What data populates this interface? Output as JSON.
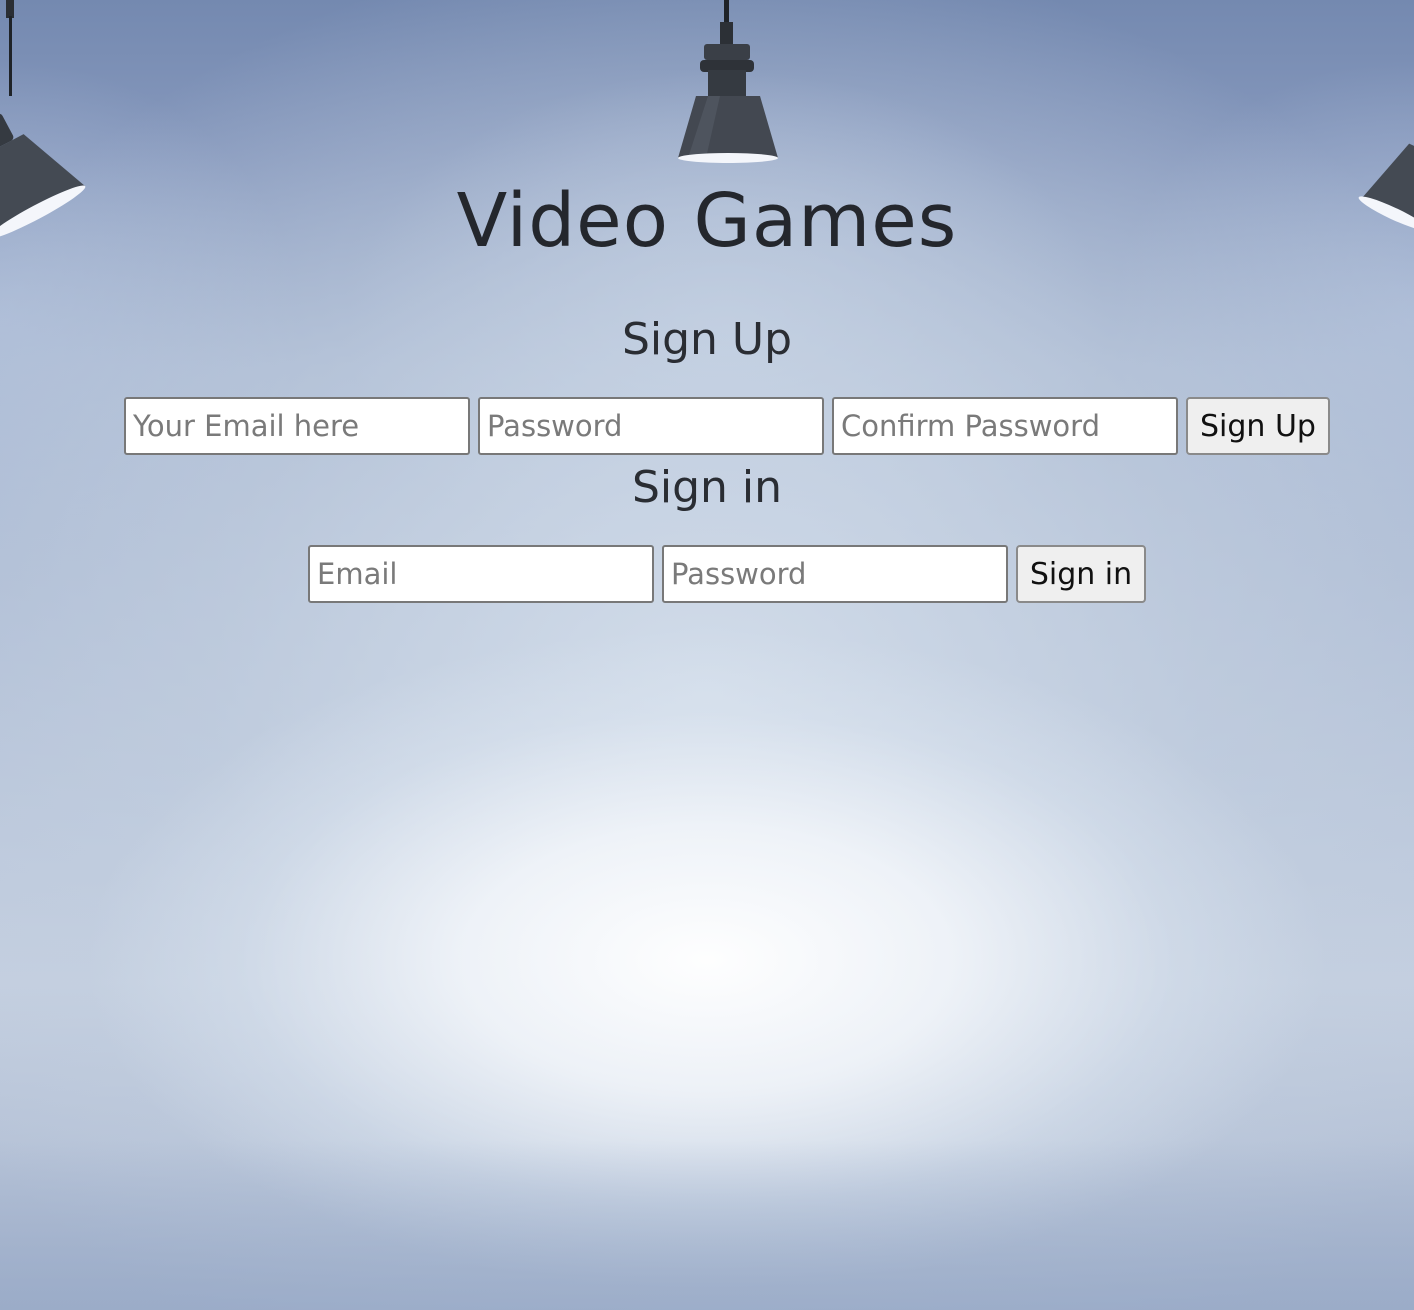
{
  "page": {
    "title": "Video Games"
  },
  "signup": {
    "heading": "Sign Up",
    "email_placeholder": "Your Email here",
    "password_placeholder": "Password",
    "confirm_placeholder": "Confirm Password",
    "button_label": "Sign Up"
  },
  "signin": {
    "heading": "Sign in",
    "email_placeholder": "Email",
    "password_placeholder": "Password",
    "button_label": "Sign in"
  },
  "decor": {
    "lamp_color": "#3f444c",
    "lamp_light": "#f4f6fb"
  }
}
